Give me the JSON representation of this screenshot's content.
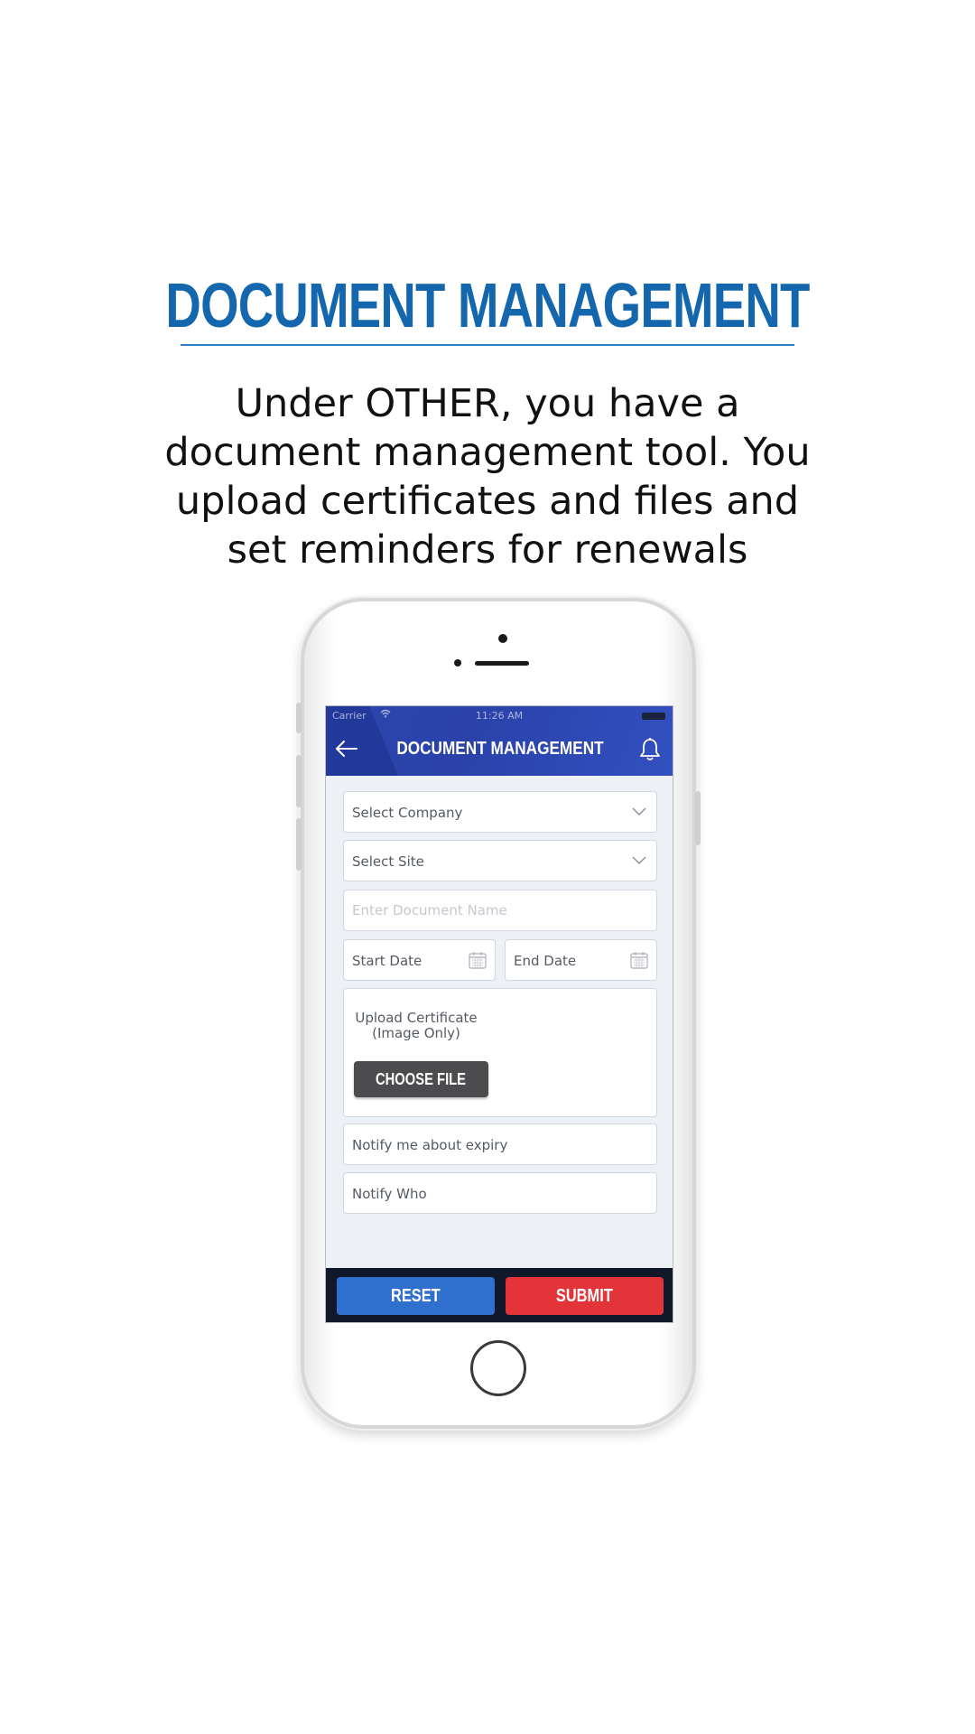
{
  "headline": "DOCUMENT MANAGEMENT",
  "subtitle": {
    "line1": "Under OTHER, you have a",
    "line2": "document management tool. You",
    "line3": "upload certificates and files and",
    "line4": "set reminders for renewals"
  },
  "phone": {
    "status_bar": {
      "carrier": "Carrier",
      "wifi_icon": "wifi-icon",
      "time": "11:26 AM",
      "battery_icon": "battery-icon"
    },
    "app_bar": {
      "back_icon": "arrow-left-icon",
      "title": "DOCUMENT MANAGEMENT",
      "bell_icon": "bell-icon"
    },
    "form": {
      "company_select": {
        "value": "Select Company",
        "icon": "chevron-down-icon"
      },
      "site_select": {
        "value": "Select Site",
        "icon": "chevron-down-icon"
      },
      "document_name": {
        "placeholder": "Enter Document Name",
        "value": ""
      },
      "start_date": {
        "value": "Start Date",
        "icon": "calendar-icon"
      },
      "end_date": {
        "value": "End Date",
        "icon": "calendar-icon"
      },
      "upload": {
        "label_line1": "Upload Certificate",
        "label_line2": "(Image Only)",
        "button": "CHOOSE FILE"
      },
      "notify_expiry": "Notify me about expiry",
      "notify_who": "Notify Who"
    },
    "actions": {
      "reset": "RESET",
      "submit": "SUBMIT"
    }
  },
  "colors": {
    "headline": "#1567ad",
    "app_bar": "#2c46ad",
    "reset": "#2f6fce",
    "submit": "#e33539",
    "choose_file": "#4c4c4e"
  }
}
